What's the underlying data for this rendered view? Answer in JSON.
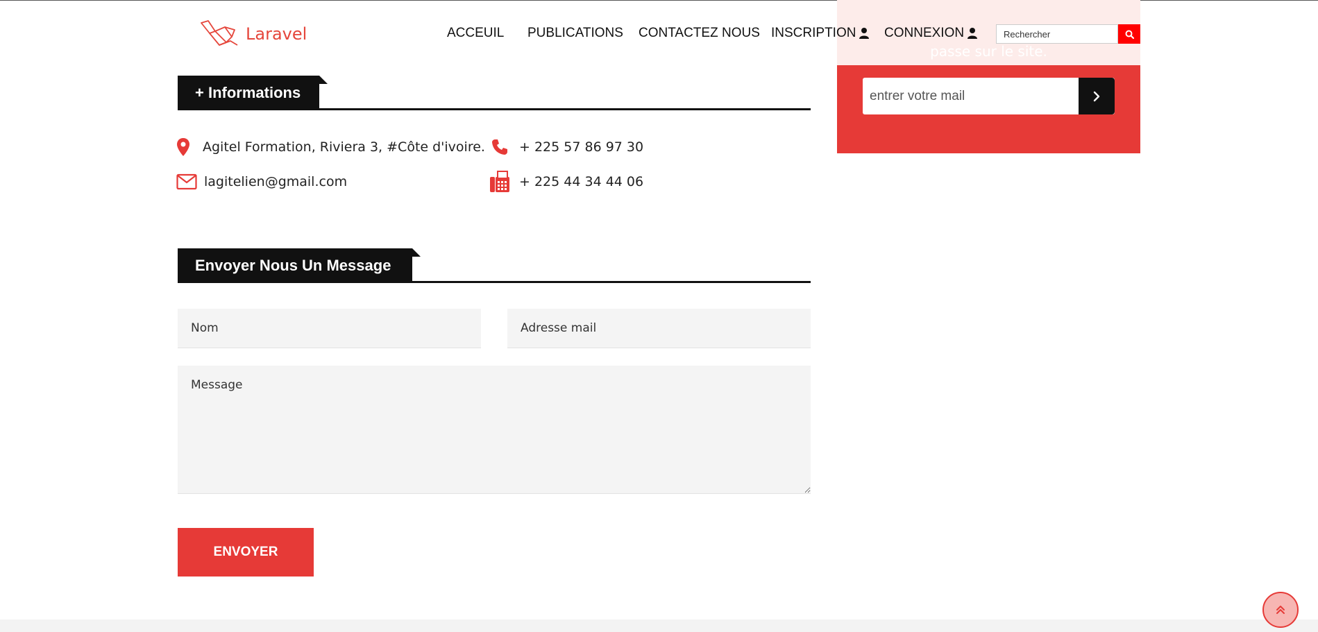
{
  "header": {
    "brand": "Laravel",
    "nav": [
      {
        "label": "ACCEUIL"
      },
      {
        "label": "PUBLICATIONS"
      },
      {
        "label": "CONTACTEZ NOUS"
      },
      {
        "label": "INSCRIPTION"
      },
      {
        "label": "CONNEXION"
      }
    ],
    "search": {
      "placeholder": "Rechercher"
    }
  },
  "newsletter": {
    "note": "passe sur le site.",
    "email_placeholder": "entrer votre mail"
  },
  "informations": {
    "heading": "+ Informations",
    "address": "Agitel Formation, Riviera 3, #Côte d'ivoire.",
    "phone": "+ 225 57 86 97 30",
    "email": "lagitelien@gmail.com",
    "fax": "+ 225 44 34 44 06"
  },
  "contact_form": {
    "heading": "Envoyer Nous Un Message",
    "name_placeholder": "Nom",
    "email_placeholder": "Adresse mail",
    "message_placeholder": "Message",
    "submit_label": "ENVOYER"
  },
  "colors": {
    "accent": "#e63a37",
    "dark": "#111111",
    "search_button": "#ff0000"
  }
}
